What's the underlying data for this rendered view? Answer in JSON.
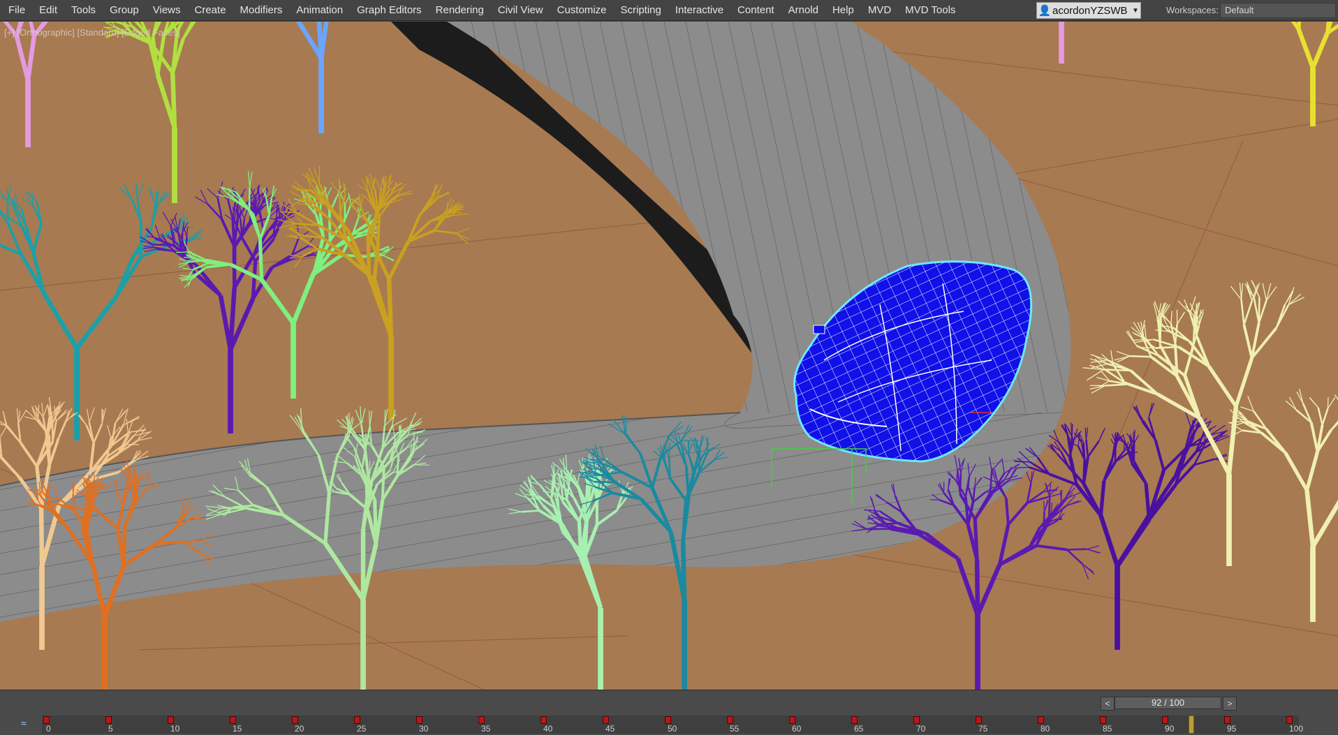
{
  "menu": {
    "items": [
      "File",
      "Edit",
      "Tools",
      "Group",
      "Views",
      "Create",
      "Modifiers",
      "Animation",
      "Graph Editors",
      "Rendering",
      "Civil View",
      "Customize",
      "Scripting",
      "Interactive",
      "Content",
      "Arnold",
      "Help",
      "MVD",
      "MVD Tools"
    ]
  },
  "user": {
    "name": "acordonYZSWB",
    "icon": "user-icon"
  },
  "workspaces": {
    "label": "Workspaces:",
    "value": "Default"
  },
  "viewport": {
    "label": "[+] [Orthographic] [Standard] [Edged Faces]"
  },
  "timeline": {
    "frame_display": "92 / 100",
    "prev_label": "<",
    "next_label": ">",
    "current_frame": 92,
    "total_frames": 100,
    "ticks": [
      "0",
      "5",
      "10",
      "15",
      "20",
      "25",
      "30",
      "35",
      "40",
      "45",
      "50",
      "55",
      "60",
      "65",
      "70",
      "75",
      "80",
      "85",
      "90",
      "95",
      "100"
    ],
    "key_frames": [
      0,
      5,
      10,
      15,
      20,
      25,
      30,
      35,
      40,
      45,
      50,
      55,
      60,
      65,
      70,
      75,
      80,
      85,
      90,
      95,
      100
    ]
  },
  "colors": {
    "ground": "#a77a52",
    "road": "#8a8a8a",
    "car_selected": "#1010e8",
    "selection_outline": "#6ee8ff"
  }
}
